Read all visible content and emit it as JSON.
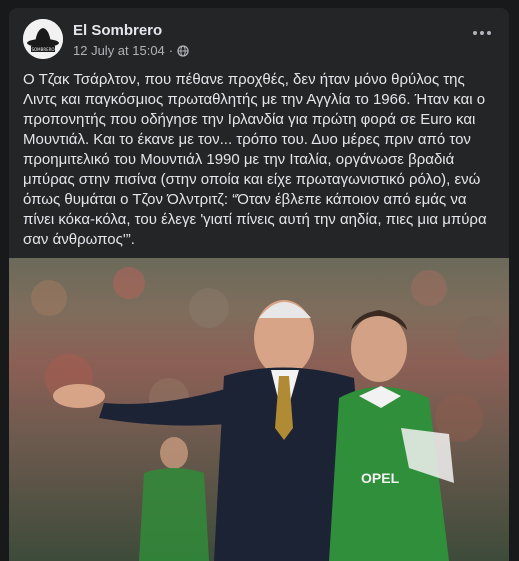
{
  "post": {
    "author": "El Sombrero",
    "avatar_text": "SOMBRERO",
    "timestamp": "12 July at 15:04",
    "separator": "·",
    "privacy_icon": "globe-icon",
    "menu_icon": "more-options-icon",
    "body": "Ο Τζακ Τσάρλτον, που πέθανε προχθές, δεν ήταν μόνο θρύλος της Λιντς και παγκόσμιος πρωταθλητής με την Αγγλία το 1966. Ήταν και ο προπονητής που οδήγησε την Ιρλανδία για πρώτη φορά σε Euro και Μουντιάλ. Και το έκανε με τον... τρόπο του. Δυο μέρες πριν από τον προημιτελικό του Μουντιάλ 1990 με την Ιταλία, οργάνωσε βραδιά μπύρας στην πισίνα (στην οποία και είχε πρωταγωνιστικό ρόλο), ενώ όπως θυμάται ο Τζον Όλντριτζ: “Όταν έβλεπε κάποιον από εμάς να πίνει κόκα-κόλα, του έλεγε 'γιατί πίνεις αυτή την αηδία, πιες μια μπύρα σαν άνθρωπος'”."
  },
  "photo": {
    "shirt_text": "OPEL",
    "colors": {
      "background": "#242526",
      "page": "#18191a",
      "text": "#e4e6eb",
      "muted": "#b0b3b8",
      "jersey": "#2f8f3a"
    }
  }
}
